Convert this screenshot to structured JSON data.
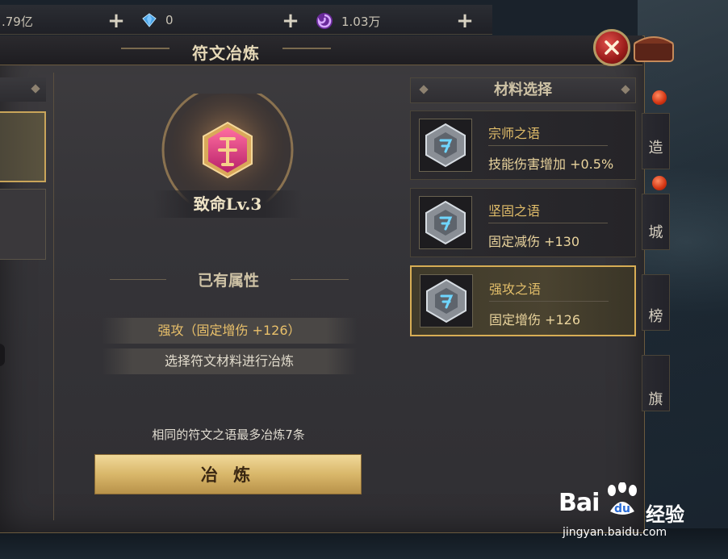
{
  "resources": {
    "gold": ".79亿",
    "diamond": "0",
    "rune_currency": "1.03万"
  },
  "window": {
    "title": "符文冶炼"
  },
  "rune": {
    "name": "致命Lv.3"
  },
  "attributes": {
    "section_title": "已有属性",
    "rows": [
      "强攻（固定增伤 +126）",
      "选择符文材料进行冶炼"
    ]
  },
  "refine": {
    "note": "相同的符文之语最多冶炼7条",
    "button_label": "冶 炼"
  },
  "materials": {
    "header": "材料选择",
    "items": [
      {
        "name": "宗师之语",
        "attr": "技能伤害增加 +0.5%",
        "selected": false
      },
      {
        "name": "坚固之语",
        "attr": "固定减伤 +130",
        "selected": false
      },
      {
        "name": "强攻之语",
        "attr": "固定增伤 +126",
        "selected": true
      }
    ]
  },
  "side_tabs": [
    "造",
    "城",
    "榜",
    "旗"
  ],
  "watermark": {
    "brand": "Bai",
    "brand_suffix": "经验",
    "url": "jingyan.baidu.com"
  },
  "colors": {
    "accent_gold": "#d7ad55",
    "close_red": "#9a1c1a",
    "highlight_text": "#e9c06a"
  }
}
